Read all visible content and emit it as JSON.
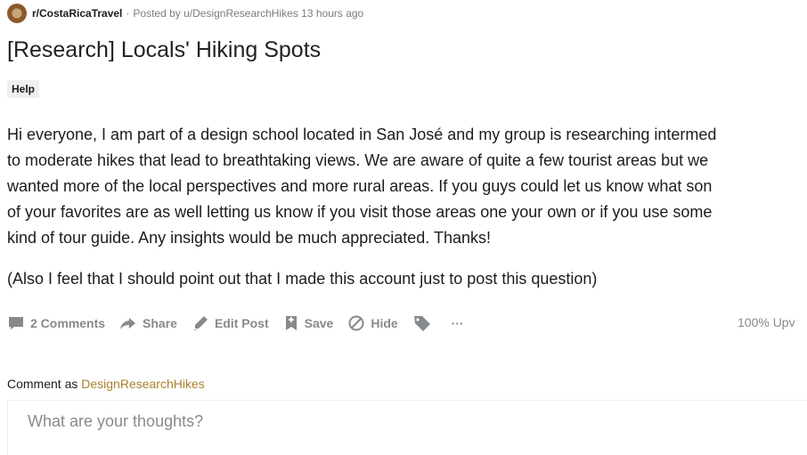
{
  "post": {
    "subreddit": "r/CostaRicaTravel",
    "separator": "·",
    "posted_by": "Posted by u/DesignResearchHikes",
    "time_ago": "13 hours ago",
    "title": "[Research] Locals' Hiking Spots",
    "flair": "Help",
    "body_lines": [
      "Hi everyone, I am part of a design school located in San José and my group is researching intermed",
      "to moderate hikes that lead to breathtaking views. We are aware of quite a few tourist areas but we",
      "wanted more of the local perspectives and more rural areas. If you guys could let us know what son",
      "of your favorites are as well letting us know if you visit those areas one your own or if you use some",
      "kind of tour guide. Any insights would be much appreciated. Thanks!"
    ],
    "body_p2": "(Also I feel that I should point out that I made this account just to post this question)"
  },
  "actions": {
    "comments": "2 Comments",
    "share": "Share",
    "edit": "Edit Post",
    "save": "Save",
    "hide": "Hide",
    "more": "···",
    "upvoted": "100% Upv"
  },
  "comment": {
    "label": "Comment as",
    "username": "DesignResearchHikes",
    "placeholder": "What are your thoughts?"
  },
  "icons": {
    "subreddit": "subreddit-avatar-icon",
    "comments": "comment-bubble-icon",
    "share": "share-arrow-icon",
    "edit": "pencil-icon",
    "save": "bookmark-icon",
    "hide": "hide-circle-icon",
    "tag": "tag-icon",
    "more": "more-icon"
  },
  "colors": {
    "icon_gray": "#878a8c",
    "username_gold": "#a8822c",
    "flair_bg": "#edeff1"
  }
}
